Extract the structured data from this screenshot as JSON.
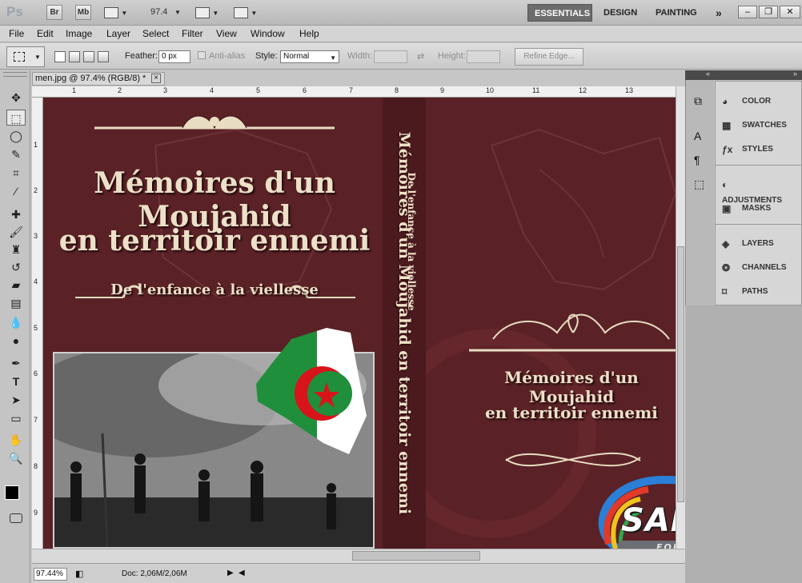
{
  "app": {
    "logo": "Ps",
    "bridge": "Br",
    "minibridge": "Mb",
    "zoom": "97.4",
    "workspaces": [
      "ESSENTIALS",
      "DESIGN",
      "PAINTING"
    ],
    "more": "»"
  },
  "menu": [
    "File",
    "Edit",
    "Image",
    "Layer",
    "Select",
    "Filter",
    "View",
    "Window",
    "Help"
  ],
  "options": {
    "feather_label": "Feather:",
    "feather_value": "0 px",
    "antialias_label": "Anti-alias",
    "style_label": "Style:",
    "style_value": "Normal",
    "width_label": "Width:",
    "height_label": "Height:",
    "refine_button": "Refine Edge..."
  },
  "document": {
    "tab_title": "men.jpg @ 97.4% (RGB/8) *",
    "close": "×",
    "ruler_top": [
      "1",
      "2",
      "3",
      "4",
      "5",
      "6",
      "7",
      "8",
      "9",
      "10",
      "11",
      "12",
      "13"
    ],
    "ruler_left": [
      "1",
      "2",
      "3",
      "4",
      "5",
      "6",
      "7",
      "8",
      "9"
    ]
  },
  "cover": {
    "front_title_line1": "Mémoires d'un Moujahid",
    "front_title_line2": "en territoir ennemi",
    "front_subtitle": "De l'enfance à la viellesse",
    "spine_title": "Mémoires d'un Moujahid en territoir ennemi",
    "spine_subtitle": "De l'enfance à la viellesse",
    "back_title_line1": "Mémoires d'un Moujahid",
    "back_title_line2": "en territoir ennemi",
    "watermark": "SAMCO",
    "watermark_tag": "FOR DESIGN",
    "flag_colors": {
      "green": "#1f8f3c",
      "white": "#ffffff",
      "red": "#d8141b"
    }
  },
  "status": {
    "zoom": "97.44%",
    "doc": "Doc: 2,06M/2,06M"
  },
  "panels": [
    {
      "label": "COLOR",
      "icon": "palette-icon"
    },
    {
      "label": "SWATCHES",
      "icon": "swatches-icon"
    },
    {
      "label": "STYLES",
      "icon": "styles-icon"
    },
    {
      "label": "ADJUSTMENTS",
      "icon": "adjustments-icon"
    },
    {
      "label": "MASKS",
      "icon": "masks-icon"
    },
    {
      "label": "LAYERS",
      "icon": "layers-icon"
    },
    {
      "label": "CHANNELS",
      "icon": "channels-icon"
    },
    {
      "label": "PATHS",
      "icon": "paths-icon"
    }
  ]
}
